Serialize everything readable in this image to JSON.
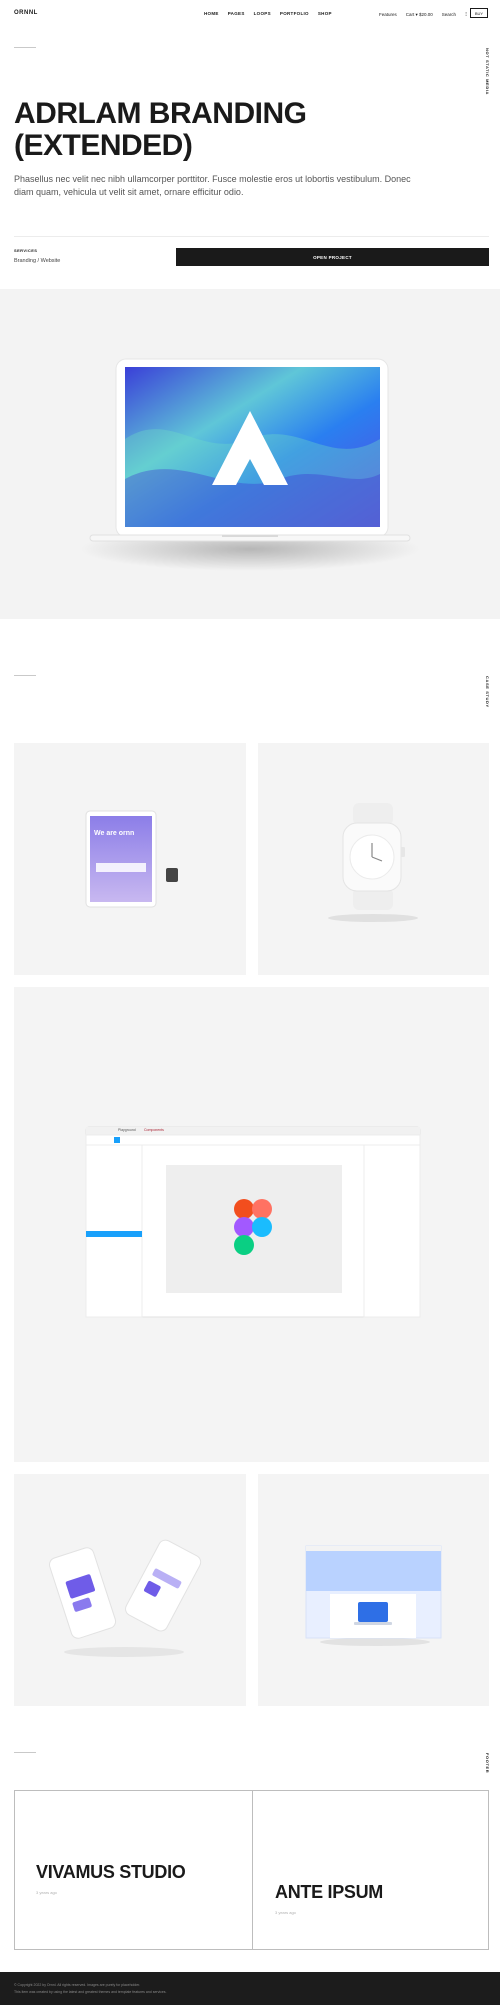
{
  "header": {
    "logo": "ORNNL",
    "nav": [
      "HOME",
      "PAGES",
      "LOOPS",
      "PORTFOLIO",
      "SHOP"
    ],
    "utilities": [
      "Features",
      "Cart ▾ $20.00",
      "Search"
    ],
    "right_button": "BUY"
  },
  "project": {
    "vertical_label": "NOT STATIC MEDIA",
    "title": "ADRLAM BRANDING (EXTENDED)",
    "description": "Phasellus nec velit nec nibh ullamcorper porttitor. Fusce molestie eros ut lobortis vestibulum. Donec diam quam, vehicula ut velit sit amet, ornare efficitur odio.",
    "services_label": "SERVICES",
    "services_value": "Branding / Website",
    "open_button": "OPEN PROJECT"
  },
  "gallery": {
    "vertical_label": "CASE STUDY",
    "tablet_text": "We are ornn",
    "figma_tabs": [
      "Playground",
      "Components"
    ]
  },
  "next_projects": {
    "vertical_label": "FOOTER",
    "items": [
      {
        "title": "VIVAMUS STUDIO",
        "time": "3 years ago"
      },
      {
        "title": "ANTE IPSUM",
        "time": "3 years ago"
      }
    ]
  },
  "footer": {
    "line1": "© Copyright 2022 by Ornnl. All rights reserved. Images are purely for placeholder.",
    "line2": "This item was created by using the latest and greatest themes and template features and services."
  },
  "colors": {
    "dark": "#1a1a1a",
    "band": "#f3f3f3",
    "tile": "#f4f4f4",
    "accent_blue": "#2e6fe6"
  }
}
